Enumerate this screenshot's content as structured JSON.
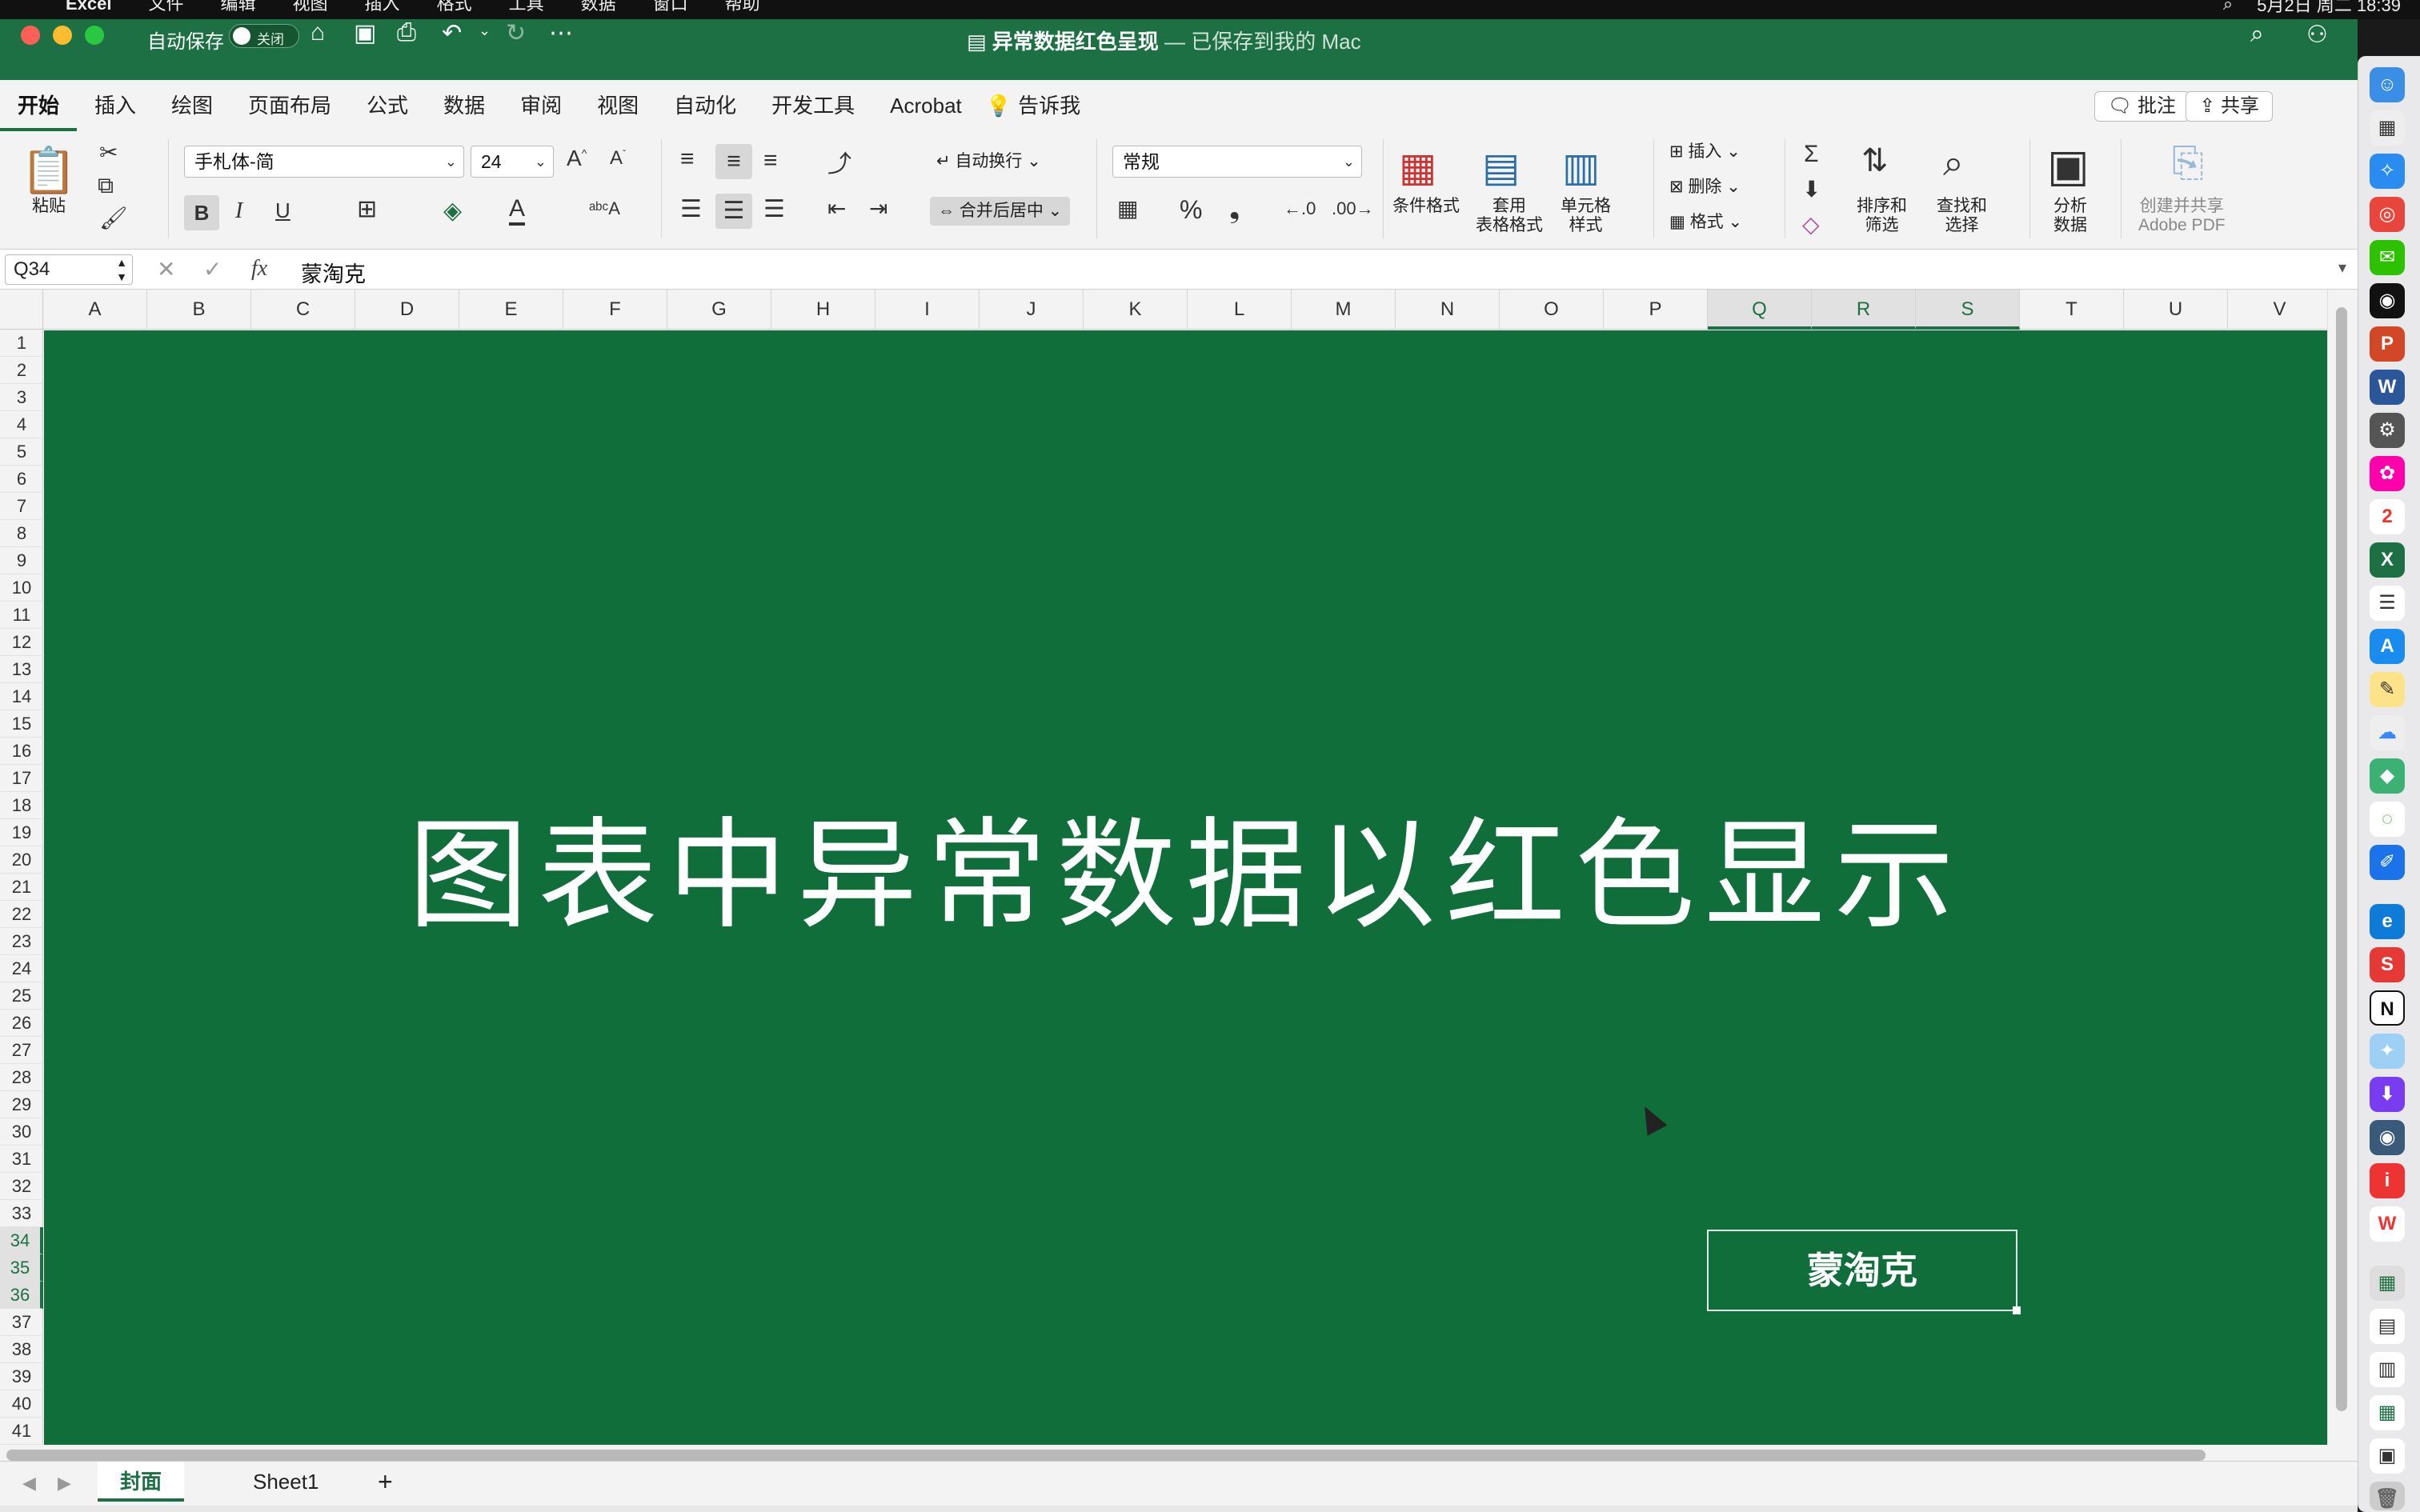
{
  "menubar": {
    "app": "Excel",
    "items": [
      "文件",
      "编辑",
      "视图",
      "插入",
      "格式",
      "工具",
      "数据",
      "窗口",
      "帮助"
    ],
    "clock": "5月2日 周二 18:39"
  },
  "window": {
    "autosave_label": "自动保存",
    "autosave_state": "关闭",
    "doc_title": "异常数据红色呈现",
    "doc_status": "— 已保存到我的 Mac"
  },
  "ribbon_tabs": [
    "开始",
    "插入",
    "绘图",
    "页面布局",
    "公式",
    "数据",
    "审阅",
    "视图",
    "自动化",
    "开发工具",
    "Acrobat"
  ],
  "tell_me": "告诉我",
  "comments_label": "批注",
  "share_label": "共享",
  "ribbon": {
    "paste_label": "粘贴",
    "font_name": "手札体-简",
    "font_size": "24",
    "bold": "B",
    "italic": "I",
    "underline": "U",
    "wrap_text": "自动换行",
    "merge_center": "合并后居中",
    "number_format": "常规",
    "percent": "%",
    "comma": "❟",
    "conditional_format": "条件格式",
    "format_as_table": "套用\n表格格式",
    "cell_styles": "单元格\n样式",
    "insert": "插入",
    "delete": "删除",
    "format": "格式",
    "sort_filter": "排序和\n筛选",
    "find_select": "查找和\n选择",
    "analyze_data": "分析\n数据",
    "create_share_pdf": "创建并共享\nAdobe PDF"
  },
  "formula_bar": {
    "name_box": "Q34",
    "fx": "fx",
    "content": "蒙淘克"
  },
  "columns": [
    "A",
    "B",
    "C",
    "D",
    "E",
    "F",
    "G",
    "H",
    "I",
    "J",
    "K",
    "L",
    "M",
    "N",
    "O",
    "P",
    "Q",
    "R",
    "S",
    "T",
    "U",
    "V"
  ],
  "selected_columns": [
    "Q",
    "R",
    "S"
  ],
  "rows": [
    "1",
    "2",
    "3",
    "4",
    "5",
    "6",
    "7",
    "8",
    "9",
    "10",
    "11",
    "12",
    "13",
    "14",
    "15",
    "16",
    "17",
    "18",
    "19",
    "20",
    "21",
    "22",
    "23",
    "24",
    "25",
    "26",
    "27",
    "28",
    "29",
    "30",
    "31",
    "32",
    "33",
    "34",
    "35",
    "36",
    "37",
    "38",
    "39",
    "40",
    "41"
  ],
  "selected_rows": [
    "34",
    "35",
    "36"
  ],
  "cover": {
    "background": "#0f6e3a",
    "title": "图表中异常数据以红色显示",
    "author": "蒙淘克"
  },
  "sheets": [
    {
      "name": "封面",
      "active": true
    },
    {
      "name": "Sheet1",
      "active": false
    }
  ],
  "add_sheet": "+",
  "colors": {
    "excel_green": "#1d7044",
    "cover_green": "#0f6e3a"
  }
}
